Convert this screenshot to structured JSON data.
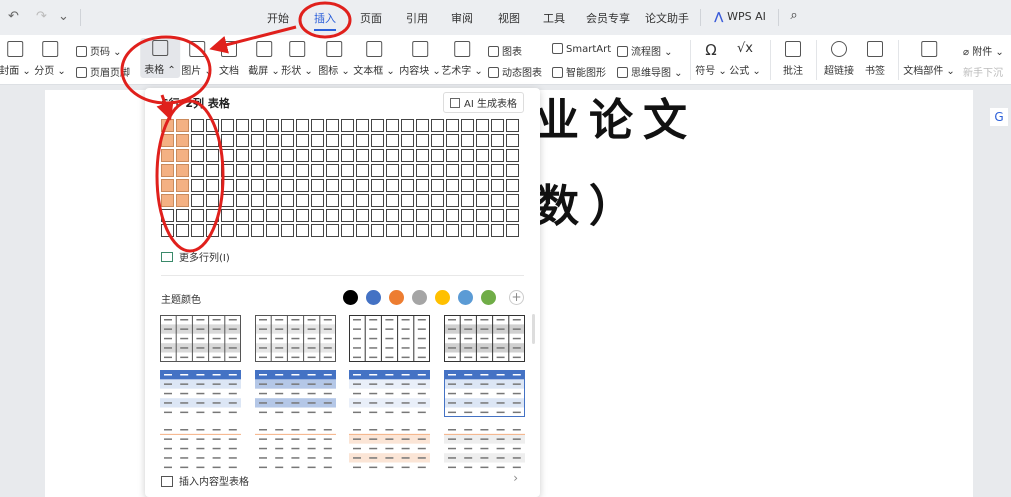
{
  "quick_access": [
    "↶",
    "↷",
    "⌄"
  ],
  "tabs": [
    {
      "label": "开始"
    },
    {
      "label": "插入",
      "active": true
    },
    {
      "label": "页面"
    },
    {
      "label": "引用"
    },
    {
      "label": "审阅"
    },
    {
      "label": "视图"
    },
    {
      "label": "工具"
    },
    {
      "label": "会员专享"
    },
    {
      "label": "论文助手"
    },
    {
      "label": "WPS AI"
    }
  ],
  "search_icon": "search-icon",
  "ribbon": {
    "cover": "封面 ⌄",
    "pagebreak": "分页 ⌄",
    "pagenum": "页码 ⌄",
    "header_footer": "页眉页脚",
    "table": "表格 ⌃",
    "picture": "图片 ⌄",
    "doc": "文档",
    "screenshot": "截屏 ⌄",
    "shape": "形状 ⌄",
    "icon": "图标 ⌄",
    "textbox": "文本框 ⌄",
    "content_block": "内容块 ⌄",
    "wordart": "艺术字 ⌄",
    "chart": "图表",
    "dyn_chart": "动态图表",
    "smartart": "SmartArt",
    "smart_shape": "智能图形",
    "flowchart": "流程图 ⌄",
    "mindmap": "思维导图 ⌄",
    "symbol": "符号 ⌄",
    "formula": "公式 ⌄",
    "comment": "批注",
    "hyperlink": "超链接",
    "bookmark": "书签",
    "doc_parts": "文档部件 ⌄",
    "attachment": "附件 ⌄",
    "novice": "新手下沉"
  },
  "document": {
    "line1": "业论文",
    "line2": "数）"
  },
  "table_panel": {
    "title": "6行*2列 表格",
    "ai_button": "AI 生成表格",
    "grid_rows": 8,
    "grid_cols": 24,
    "selected_rows": 6,
    "selected_cols": 2,
    "more": "更多行列(I)",
    "theme_label": "主题颜色",
    "theme_colors": [
      "#000000",
      "#4472c4",
      "#ed7d31",
      "#a5a5a5",
      "#ffc000",
      "#5b9bd5",
      "#70ad47"
    ],
    "table_styles": [
      {
        "accent": "#555555",
        "fill": "#d9d9d9"
      },
      {
        "accent": "#555555",
        "fill": "#e6e6e6"
      },
      {
        "accent": "#333333",
        "fill": "#ffffff"
      },
      {
        "accent": "#333333",
        "fill": "#d0d0d0"
      },
      {
        "accent": "#4472c4",
        "fill": "#dce6f5"
      },
      {
        "accent": "#4472c4",
        "fill": "#b4c7e7"
      },
      {
        "accent": "#4472c4",
        "fill": "#e9eff9"
      },
      {
        "accent": "#4472c4",
        "fill": "#dce6f5"
      },
      {
        "accent": "#f4b183",
        "fill": "#ffffff"
      },
      {
        "accent": "#f4b183",
        "fill": "#ffffff"
      },
      {
        "accent": "#f4b183",
        "fill": "#fbe5d6"
      },
      {
        "accent": "#f4b183",
        "fill": "#eeeeee"
      }
    ],
    "insert_content_table": "插入内容型表格"
  },
  "annotation_color": "#e0201c"
}
